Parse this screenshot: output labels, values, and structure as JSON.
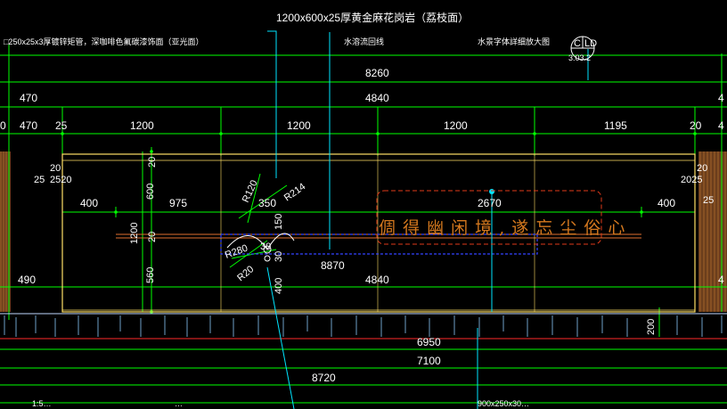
{
  "annotations": {
    "top_material": "1200x600x25厚黄金麻花岗岩（荔枝面）",
    "left_material": "□250x25x3厚镀锌矩管，深咖啡色氟碳漆饰面（亚光面）",
    "water_line": "水溶流回线",
    "water_detail": "水景字体詳细放大图",
    "bottom_left_1": "1:5…",
    "bottom_left_2": "…",
    "bottom_right": "900x250x30…"
  },
  "detail_callout": {
    "top": "C",
    "ref": "LD",
    "sheet": "3.03.2"
  },
  "motto": "倜 得 幽 闲 境 , 遂 忘 尘 俗 心",
  "dimensions": {
    "row1": [
      "8260"
    ],
    "row2": [
      "470",
      "4840",
      "4"
    ],
    "row3": [
      "0",
      "470",
      "25",
      "1200",
      "1200",
      "1200",
      "1195",
      "20",
      "4"
    ],
    "row_inner": [
      "400",
      "975",
      "350",
      "2670",
      "400"
    ],
    "left_small": [
      "20",
      "25",
      "2520"
    ],
    "right_small": [
      "20",
      "2025",
      "25"
    ],
    "vertical": [
      "20",
      "600",
      "1200",
      "20",
      "560",
      "150",
      "30",
      "400",
      "200"
    ],
    "radii": [
      "R120",
      "R214",
      "R280",
      "R20"
    ],
    "middle": [
      "8870",
      "4840",
      "490",
      "4"
    ],
    "bottom": [
      "6950",
      "7100",
      "8720"
    ]
  }
}
